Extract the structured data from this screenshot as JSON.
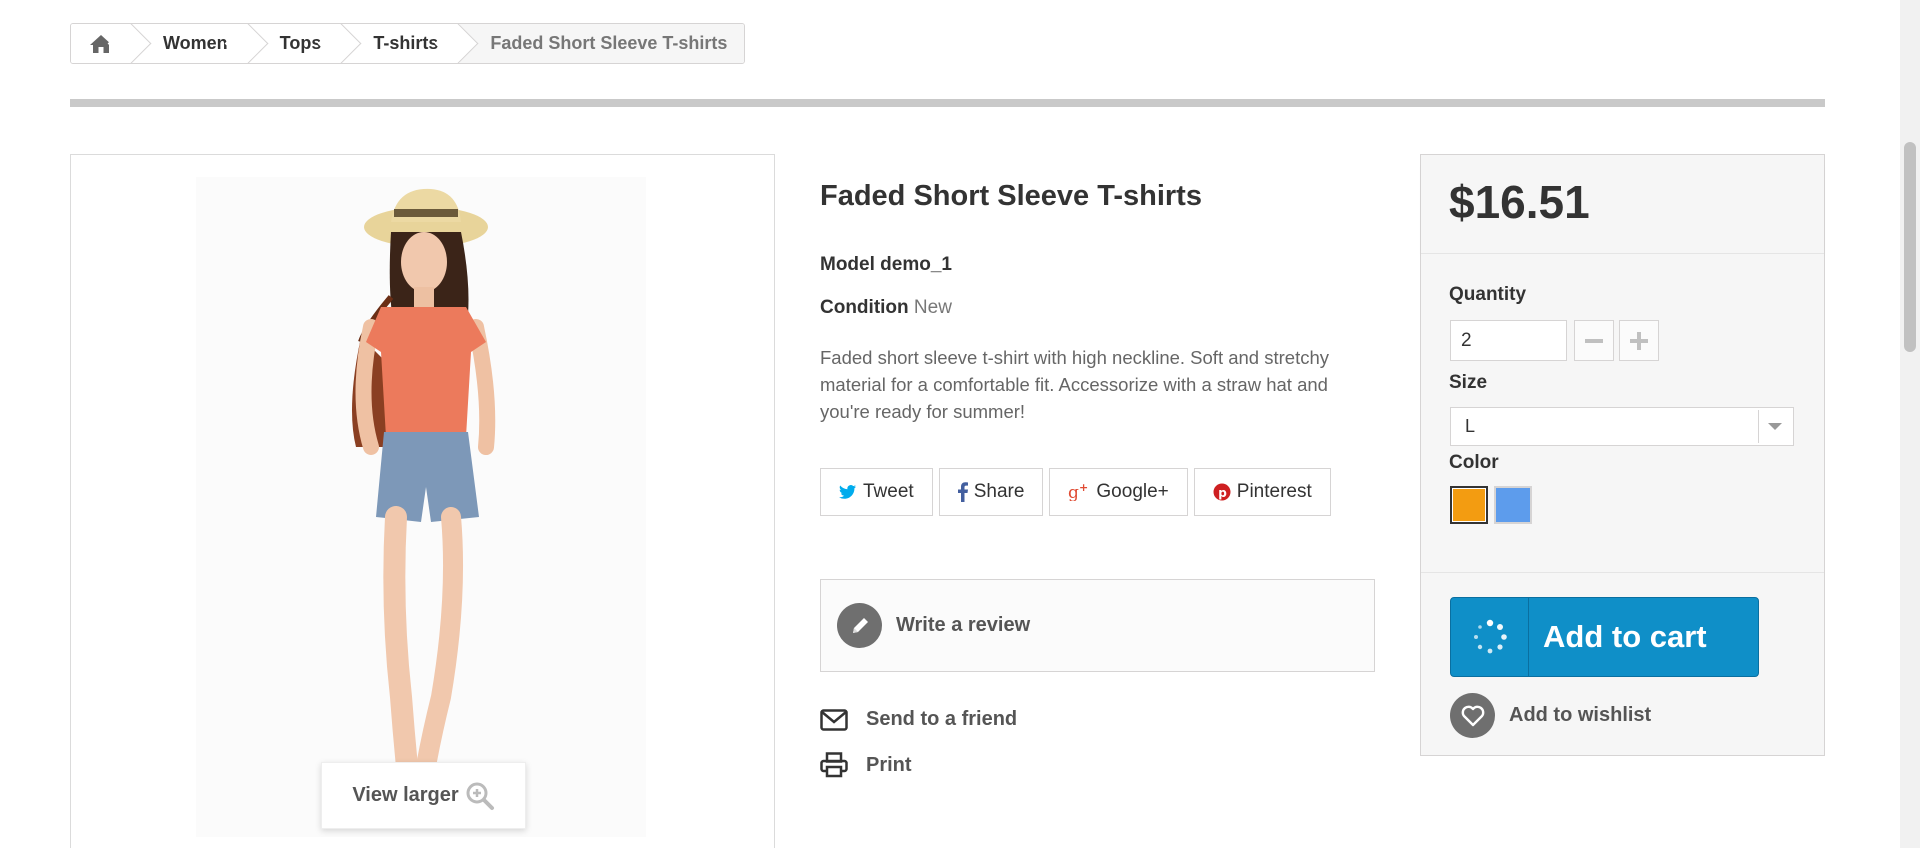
{
  "breadcrumb": {
    "home_icon": "home-icon",
    "items": [
      "Women",
      "Tops",
      "T-shirts"
    ],
    "current": "Faded Short Sleeve T-shirts"
  },
  "image": {
    "view_larger": "View larger",
    "zoom_icon": "zoom-in-icon"
  },
  "product": {
    "title": "Faded Short Sleeve T-shirts",
    "model_label": "Model",
    "model_value": "demo_1",
    "condition_label": "Condition",
    "condition_value": "New",
    "description": "Faded short sleeve t-shirt with high neckline. Soft and stretchy material for a comfortable fit. Accessorize with a straw hat and you're ready for summer!"
  },
  "social": {
    "tweet": "Tweet",
    "share": "Share",
    "google": "Google+",
    "pinterest": "Pinterest"
  },
  "actions": {
    "review": "Write a review",
    "send_friend": "Send to a friend",
    "print": "Print"
  },
  "buy": {
    "price": "$16.51",
    "quantity_label": "Quantity",
    "quantity_value": "2",
    "size_label": "Size",
    "size_value": "L",
    "color_label": "Color",
    "colors": [
      "#f39c11",
      "#5d9cec"
    ],
    "add_to_cart": "Add to cart",
    "wishlist": "Add to wishlist"
  },
  "colors": {
    "accent": "#0f8fc8",
    "twitter": "#00aced",
    "facebook": "#435f9f",
    "google": "#e04b33",
    "pinterest": "#ce1f21"
  }
}
